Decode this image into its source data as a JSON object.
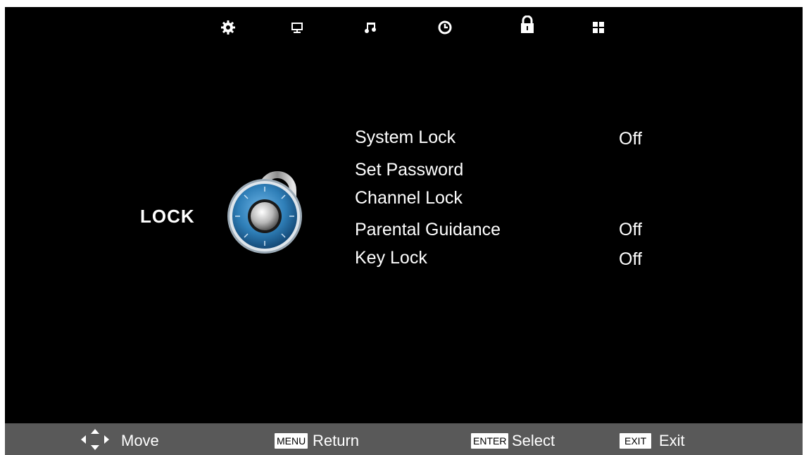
{
  "top_tabs": [
    {
      "icon": "gear-icon",
      "label": "Setup"
    },
    {
      "icon": "monitor-icon",
      "label": "Picture"
    },
    {
      "icon": "music-note-icon",
      "label": "Sound"
    },
    {
      "icon": "clock-icon",
      "label": "Time"
    },
    {
      "icon": "lock-icon",
      "label": "Lock",
      "active": true
    },
    {
      "icon": "grid-icon",
      "label": "Apps"
    }
  ],
  "section": {
    "title": "LOCK",
    "icon": "padlock-dial-icon"
  },
  "menu": {
    "items": [
      {
        "label": "System Lock",
        "value": "Off"
      },
      {
        "label": "Set Password",
        "value": ""
      },
      {
        "label": "Channel Lock",
        "value": ""
      },
      {
        "label": "Parental Guidance",
        "value": "Off"
      },
      {
        "label": "Key Lock",
        "value": "Off"
      }
    ]
  },
  "footer": {
    "move_label": "Move",
    "menu_key": "MENU",
    "return_label": "Return",
    "enter_key": "ENTER",
    "select_label": "Select",
    "exit_key": "EXIT",
    "exit_label": "Exit"
  },
  "colors": {
    "background": "#000000",
    "footer": "#595959",
    "text": "#ffffff",
    "dial_blue": "#2f7fb8"
  }
}
